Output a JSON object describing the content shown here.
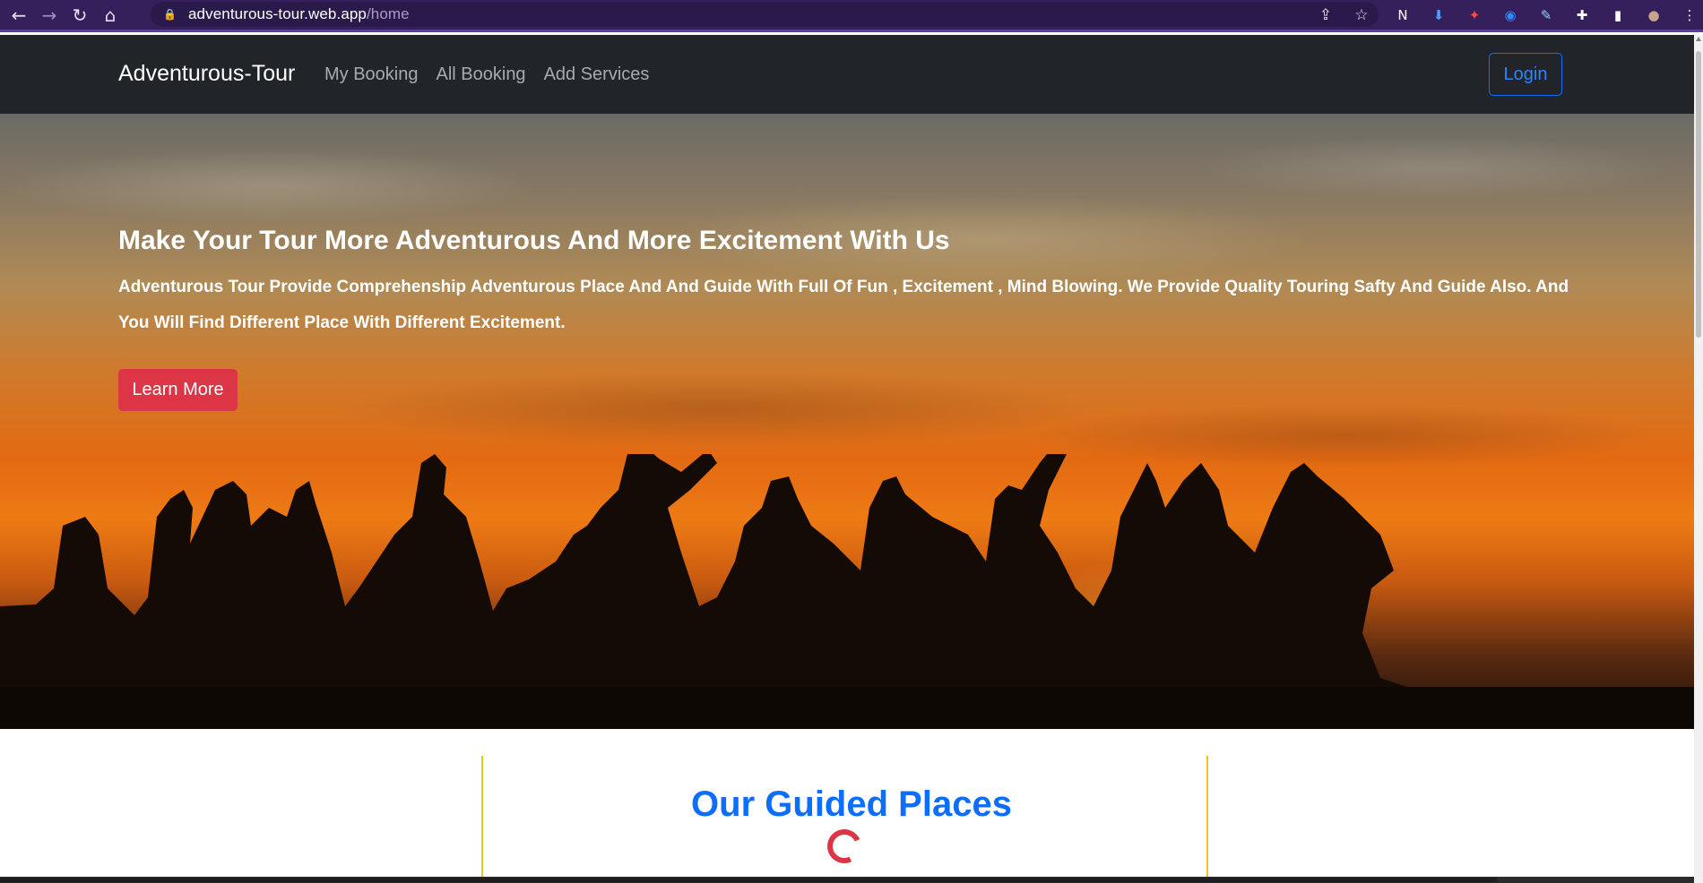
{
  "browser": {
    "url_host": "adventurous-tour.web.app",
    "url_path": "/home",
    "back_icon": "←",
    "forward_icon": "→",
    "reload_icon": "↻",
    "home_icon": "⌂",
    "lock_icon": "🔒",
    "share_icon": "⇪",
    "star_icon": "☆",
    "extensions": [
      {
        "name": "notion-extension-icon",
        "glyph": "N",
        "color": "#ffffff"
      },
      {
        "name": "download-extension-icon",
        "glyph": "⬇",
        "color": "#4aa3ff"
      },
      {
        "name": "red-extension-icon",
        "glyph": "✦",
        "color": "#ff4b3e"
      },
      {
        "name": "zoom-extension-icon",
        "glyph": "◉",
        "color": "#2d8cff"
      },
      {
        "name": "eyedropper-extension-icon",
        "glyph": "✎",
        "color": "#8fd0ff"
      },
      {
        "name": "puzzle-extensions-icon",
        "glyph": "✚",
        "color": "#ffffff"
      },
      {
        "name": "side-panel-icon",
        "glyph": "▮",
        "color": "#ffffff"
      },
      {
        "name": "profile-avatar",
        "glyph": "●",
        "color": "#c9a48a"
      },
      {
        "name": "browser-menu-icon",
        "glyph": "⋮",
        "color": "#ffffff"
      }
    ]
  },
  "navbar": {
    "brand": "Adventurous-Tour",
    "links": [
      "My Booking",
      "All Booking",
      "Add Services"
    ],
    "login_label": "Login"
  },
  "hero": {
    "title": "Make Your Tour More Adventurous And More Excitement With Us",
    "subtitle": "Adventurous Tour Provide Comprehenship Adventurous Place And And Guide With Full Of Fun , Excitement , Mind Blowing. We Provide Quality Touring Safty And Guide Also. And You Will Find Different Place With Different Excitement.",
    "cta_label": "Learn More"
  },
  "section": {
    "title": "Our Guided Places"
  },
  "colors": {
    "chrome_bg": "#35205c",
    "navbar_bg": "#212529",
    "primary": "#0d6efd",
    "danger": "#dc3545",
    "accent_border": "#f0c419"
  }
}
